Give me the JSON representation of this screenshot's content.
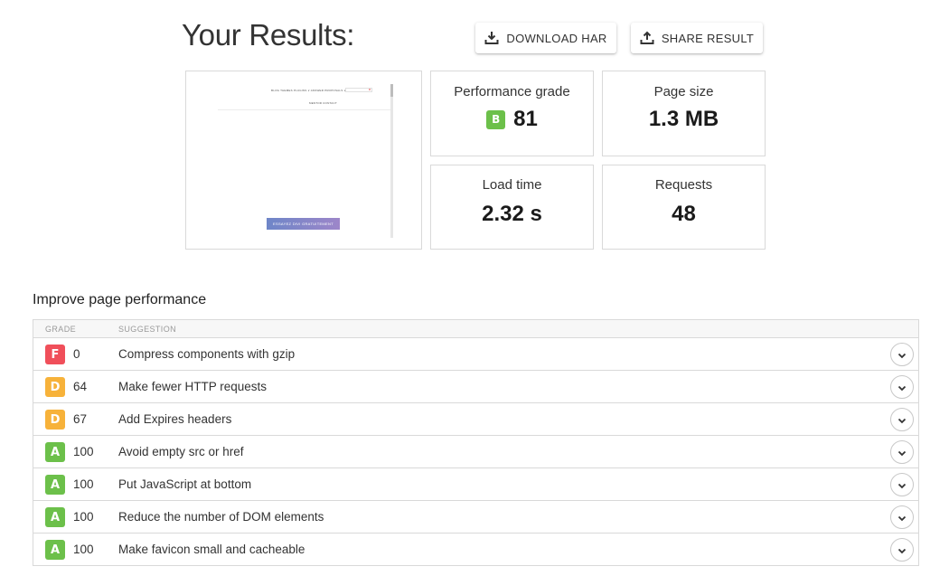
{
  "header": {
    "title": "Your Results:"
  },
  "actions": {
    "download_label": "DOWNLOAD HAR",
    "share_label": "SHARE RESULT"
  },
  "preview": {
    "nav_row1": "BLOG   THEMES PLUGINS ∨   ANSWER PROPOSALS ∨",
    "nav_row2": "MENTOR   CONTACT",
    "cta": "ESSAYEZ DIVI GRATUITEMENT"
  },
  "metrics": {
    "grade": {
      "label": "Performance grade",
      "letter": "B",
      "value": "81",
      "color": "#6cc04a"
    },
    "size": {
      "label": "Page size",
      "value": "1.3 MB"
    },
    "load": {
      "label": "Load time",
      "value": "2.32 s"
    },
    "requests": {
      "label": "Requests",
      "value": "48"
    }
  },
  "improve": {
    "title": "Improve page performance",
    "col_grade": "GRADE",
    "col_suggestion": "SUGGESTION",
    "rows": [
      {
        "grade": "F",
        "score": "0",
        "suggestion": "Compress components with gzip",
        "color": "#f04f5a"
      },
      {
        "grade": "D",
        "score": "64",
        "suggestion": "Make fewer HTTP requests",
        "color": "#f7b23a"
      },
      {
        "grade": "D",
        "score": "67",
        "suggestion": "Add Expires headers",
        "color": "#f7b23a"
      },
      {
        "grade": "A",
        "score": "100",
        "suggestion": "Avoid empty src or href",
        "color": "#6cc04a"
      },
      {
        "grade": "A",
        "score": "100",
        "suggestion": "Put JavaScript at bottom",
        "color": "#6cc04a"
      },
      {
        "grade": "A",
        "score": "100",
        "suggestion": "Reduce the number of DOM elements",
        "color": "#6cc04a"
      },
      {
        "grade": "A",
        "score": "100",
        "suggestion": "Make favicon small and cacheable",
        "color": "#6cc04a"
      }
    ]
  }
}
